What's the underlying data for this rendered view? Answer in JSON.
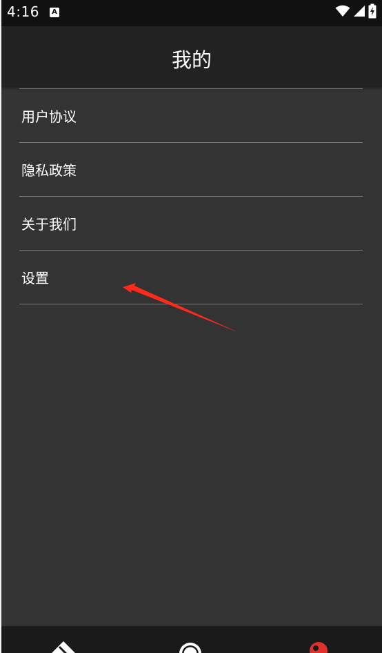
{
  "status_bar": {
    "time": "4:16",
    "notification_icon": "a-icon",
    "icons": [
      "wifi-icon",
      "cell-signal-icon",
      "battery-charging-icon"
    ]
  },
  "header": {
    "title": "我的"
  },
  "menu": {
    "items": [
      {
        "label": "用户协议"
      },
      {
        "label": "隐私政策"
      },
      {
        "label": "关于我们"
      },
      {
        "label": "设置"
      }
    ]
  },
  "annotation": {
    "icon": "red-arrow",
    "color": "#ff2a1a",
    "points_to": "设置"
  },
  "bottom_nav": {
    "tabs": [
      {
        "icon": "diamond-icon",
        "color": "#ffffff"
      },
      {
        "icon": "ring-icon",
        "color": "#ffffff"
      },
      {
        "icon": "profile-icon",
        "color": "#e0312a",
        "active": true
      }
    ]
  },
  "colors": {
    "background": "#333333",
    "app_bar": "#222222",
    "status_bar": "#111111",
    "divider": "#7a7a7a",
    "accent": "#e0312a"
  }
}
